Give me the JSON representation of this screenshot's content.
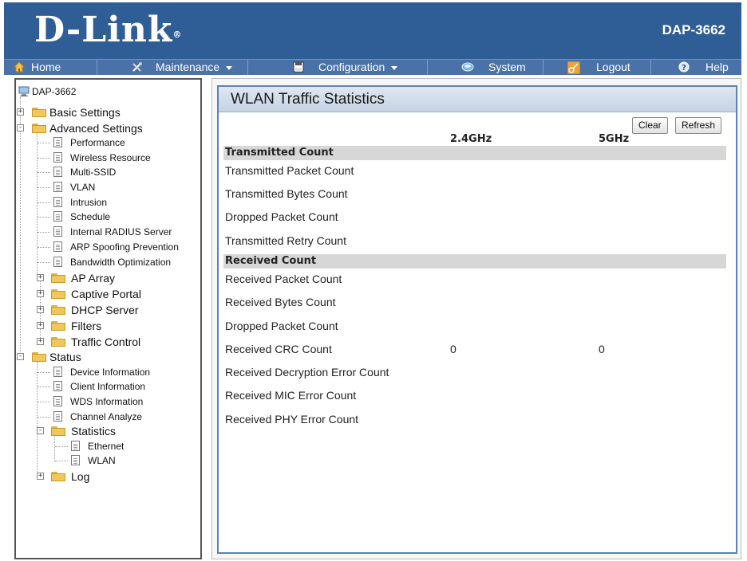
{
  "header": {
    "logo": "D-Link",
    "logo_mark": "®",
    "model": "DAP-3662"
  },
  "nav": {
    "home": "Home",
    "maintenance": "Maintenance",
    "configuration": "Configuration",
    "system": "System",
    "logout": "Logout",
    "help": "Help"
  },
  "tree": {
    "root": "DAP-3662",
    "basic_settings": "Basic Settings",
    "advanced_settings": "Advanced Settings",
    "advanced_items": [
      "Performance",
      "Wireless Resource",
      "Multi-SSID",
      "VLAN",
      "Intrusion",
      "Schedule",
      "Internal RADIUS Server",
      "ARP Spoofing Prevention",
      "Bandwidth Optimization"
    ],
    "advanced_folders": [
      "AP Array",
      "Captive Portal",
      "DHCP Server",
      "Filters",
      "Traffic Control"
    ],
    "status": "Status",
    "status_items": [
      "Device Information",
      "Client Information",
      "WDS Information",
      "Channel Analyze"
    ],
    "statistics": "Statistics",
    "statistics_items": [
      "Ethernet",
      "WLAN"
    ],
    "log": "Log"
  },
  "main": {
    "title": "WLAN Traffic Statistics",
    "clear_label": "Clear",
    "refresh_label": "Refresh",
    "col_24": "2.4GHz",
    "col_5": "5GHz",
    "transmitted_header": "Transmitted Count",
    "transmitted_rows": [
      {
        "label": "Transmitted Packet Count",
        "v24": "",
        "v5": ""
      },
      {
        "label": "Transmitted Bytes Count",
        "v24": "",
        "v5": ""
      },
      {
        "label": "Dropped Packet Count",
        "v24": "",
        "v5": ""
      },
      {
        "label": "Transmitted Retry Count",
        "v24": "",
        "v5": ""
      }
    ],
    "received_header": "Received Count",
    "received_rows": [
      {
        "label": "Received Packet Count",
        "v24": "",
        "v5": ""
      },
      {
        "label": "Received Bytes Count",
        "v24": "",
        "v5": ""
      },
      {
        "label": "Dropped Packet Count",
        "v24": "",
        "v5": ""
      },
      {
        "label": "Received CRC Count",
        "v24": "0",
        "v5": "0"
      },
      {
        "label": "Received Decryption Error Count",
        "v24": "",
        "v5": ""
      },
      {
        "label": "Received MIC Error Count",
        "v24": "",
        "v5": ""
      },
      {
        "label": "Received PHY Error Count",
        "v24": "",
        "v5": ""
      }
    ]
  },
  "colors": {
    "header_bg": "#2f5d96",
    "nav_bg": "#4a72a8",
    "panel_border": "#5a82b4",
    "section_bg": "#d7d7d7"
  }
}
